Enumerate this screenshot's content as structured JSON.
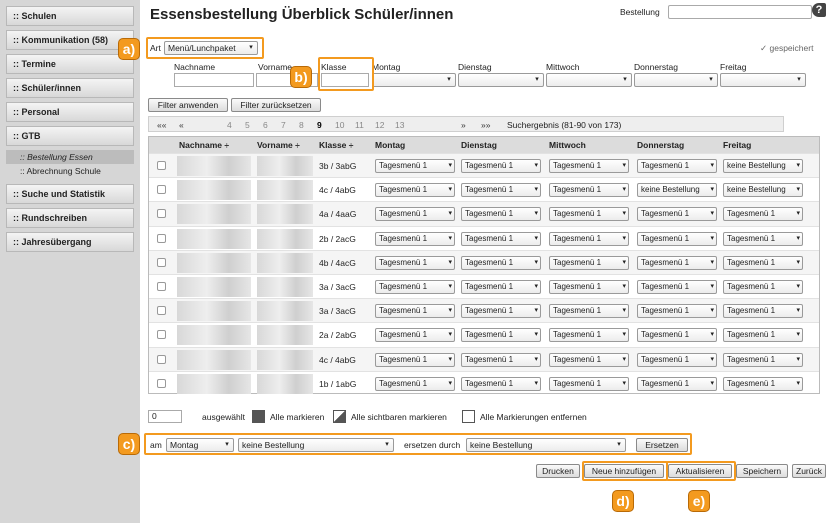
{
  "sidebar": {
    "items": [
      {
        "label": ":: Schulen"
      },
      {
        "label": ":: Kommunikation (58)"
      },
      {
        "label": ":: Termine"
      },
      {
        "label": ":: Schüler/innen"
      },
      {
        "label": ":: Personal"
      },
      {
        "label": ":: GTB"
      }
    ],
    "gtb_sub": [
      {
        "label": ":: Bestellung Essen"
      },
      {
        "label": ":: Abrechnung Schule"
      }
    ],
    "more": [
      {
        "label": ":: Suche und Statistik"
      },
      {
        "label": ":: Rundschreiben"
      },
      {
        "label": ":: Jahresübergang"
      }
    ]
  },
  "header": {
    "title": "Essensbestellung Überblick Schüler/innen",
    "bestellung_label": "Bestellung",
    "help": "?",
    "art_label": "Art",
    "art_value": "Menü/Lunchpaket",
    "saved_label": "gespeichert"
  },
  "filter": {
    "labels": [
      "Nachname",
      "Vorname",
      "Klasse",
      "Montag",
      "Dienstag",
      "Mittwoch",
      "Donnerstag",
      "Freitag"
    ],
    "apply": "Filter anwenden",
    "reset": "Filter zurücksetzen"
  },
  "pager": {
    "first": "««",
    "prev": "«",
    "pages": [
      "4",
      "5",
      "6",
      "7",
      "8",
      "9",
      "10",
      "11",
      "12",
      "13"
    ],
    "current": "9",
    "next": "»",
    "last": "»»",
    "result": "Suchergebnis (81-90 von 173)"
  },
  "table": {
    "headers": [
      "Nachname ÷",
      "Vorname ÷",
      "Klasse ÷",
      "Montag",
      "Dienstag",
      "Mittwoch",
      "Donnerstag",
      "Freitag"
    ],
    "rows": [
      {
        "klasse": "3b / 3abG",
        "days": [
          "Tagesmenü 1",
          "Tagesmenü 1",
          "Tagesmenü 1",
          "Tagesmenü 1",
          "keine Bestellung"
        ]
      },
      {
        "klasse": "4c / 4abG",
        "days": [
          "Tagesmenü 1",
          "Tagesmenü 1",
          "Tagesmenü 1",
          "keine Bestellung",
          "keine Bestellung"
        ]
      },
      {
        "klasse": "4a / 4aaG",
        "days": [
          "Tagesmenü 1",
          "Tagesmenü 1",
          "Tagesmenü 1",
          "Tagesmenü 1",
          "Tagesmenü 1"
        ]
      },
      {
        "klasse": "2b / 2acG",
        "days": [
          "Tagesmenü 1",
          "Tagesmenü 1",
          "Tagesmenü 1",
          "Tagesmenü 1",
          "Tagesmenü 1"
        ]
      },
      {
        "klasse": "4b / 4acG",
        "days": [
          "Tagesmenü 1",
          "Tagesmenü 1",
          "Tagesmenü 1",
          "Tagesmenü 1",
          "Tagesmenü 1"
        ]
      },
      {
        "klasse": "3a / 3acG",
        "days": [
          "Tagesmenü 1",
          "Tagesmenü 1",
          "Tagesmenü 1",
          "Tagesmenü 1",
          "Tagesmenü 1"
        ]
      },
      {
        "klasse": "3a / 3acG",
        "days": [
          "Tagesmenü 1",
          "Tagesmenü 1",
          "Tagesmenü 1",
          "Tagesmenü 1",
          "Tagesmenü 1"
        ]
      },
      {
        "klasse": "2a / 2abG",
        "days": [
          "Tagesmenü 1",
          "Tagesmenü 1",
          "Tagesmenü 1",
          "Tagesmenü 1",
          "Tagesmenü 1"
        ]
      },
      {
        "klasse": "4c / 4abG",
        "days": [
          "Tagesmenü 1",
          "Tagesmenü 1",
          "Tagesmenü 1",
          "Tagesmenü 1",
          "Tagesmenü 1"
        ]
      },
      {
        "klasse": "1b / 1abG",
        "days": [
          "Tagesmenü 1",
          "Tagesmenü 1",
          "Tagesmenü 1",
          "Tagesmenü 1",
          "Tagesmenü 1"
        ]
      }
    ]
  },
  "selection": {
    "count": "0",
    "count_label": "ausgewählt",
    "mark_all": "Alle markieren",
    "mark_visible": "Alle sichtbaren markieren",
    "unmark_all": "Alle Markierungen entfernen"
  },
  "replace": {
    "am_label": "am",
    "day_value": "Montag",
    "from_value": "keine Bestellung",
    "ersetzen_durch_label": "ersetzen durch",
    "to_value": "keine Bestellung",
    "button": "Ersetzen"
  },
  "actions": {
    "drucken": "Drucken",
    "neu": "Neue hinzufügen",
    "aktualisieren": "Aktualisieren",
    "speichern": "Speichern",
    "zurueck": "Zurück"
  },
  "annotations": {
    "a": "a)",
    "b": "b)",
    "c": "c)",
    "d": "d)",
    "e": "e)"
  },
  "colors": {
    "highlight": "#f39a1f",
    "sidebar_bg": "#d6d6d6"
  }
}
